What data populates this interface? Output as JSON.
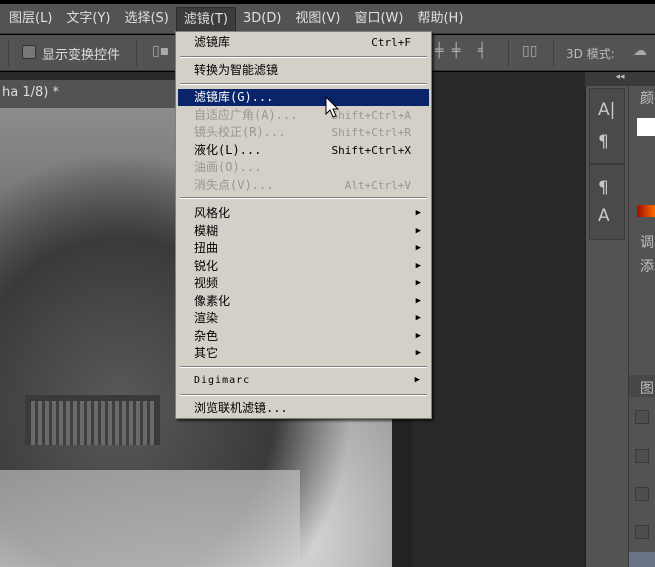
{
  "menubar": [
    "图层(L)",
    "文字(Y)",
    "选择(S)",
    "滤镜(T)",
    "3D(D)",
    "视图(V)",
    "窗口(W)",
    "帮助(H)"
  ],
  "options": {
    "show_transform": "显示变换控件",
    "mode_3d": "3D 模式:"
  },
  "document": {
    "tab_title": "ha 1/8) *"
  },
  "right_panel": {
    "collapse": "◂◂",
    "color_tab": "颜",
    "adjust_tab": "调",
    "add_label": "添",
    "layers_tab": "图"
  },
  "filter_menu": {
    "last_filter": {
      "label": "滤镜库",
      "shortcut": "Ctrl+F"
    },
    "smart": "转换为智能滤镜",
    "items": [
      {
        "label": "滤镜库(G)...",
        "shortcut": "",
        "state": "highlighted"
      },
      {
        "label": "自适应广角(A)...",
        "shortcut": "Shift+Ctrl+A",
        "state": "disabled"
      },
      {
        "label": "镜头校正(R)...",
        "shortcut": "Shift+Ctrl+R",
        "state": "disabled"
      },
      {
        "label": "液化(L)...",
        "shortcut": "Shift+Ctrl+X",
        "state": "enabled"
      },
      {
        "label": "油画(O)...",
        "shortcut": "",
        "state": "disabled"
      },
      {
        "label": "消失点(V)...",
        "shortcut": "Alt+Ctrl+V",
        "state": "disabled"
      }
    ],
    "submenus": [
      "风格化",
      "模糊",
      "扭曲",
      "锐化",
      "视频",
      "像素化",
      "渲染",
      "杂色",
      "其它"
    ],
    "digimarc": "Digimarc",
    "browse": "浏览联机滤镜..."
  }
}
